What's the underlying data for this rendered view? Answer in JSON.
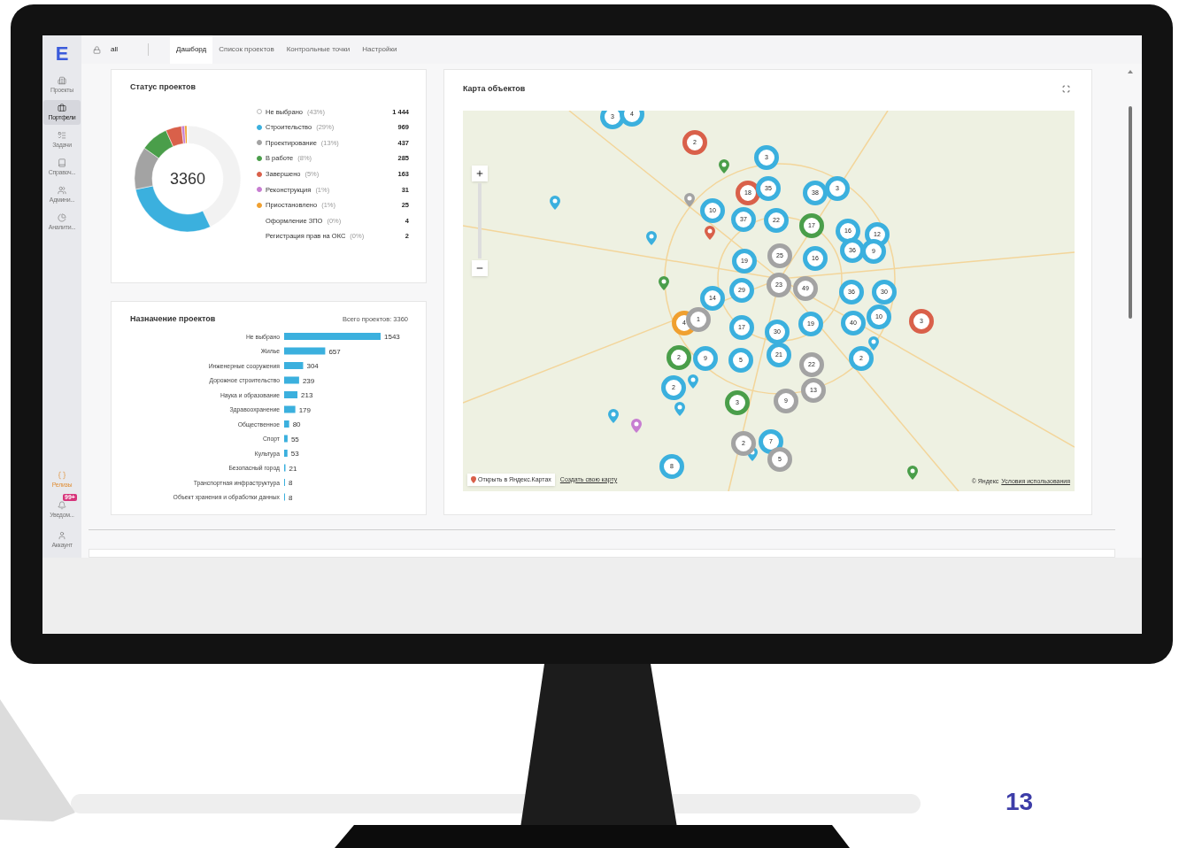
{
  "sidebar": {
    "logo": "E",
    "items": [
      {
        "label": "Проекты",
        "selected": false
      },
      {
        "label": "Портфели",
        "selected": true
      },
      {
        "label": "Задачи",
        "selected": false
      },
      {
        "label": "Справоч...",
        "selected": false
      },
      {
        "label": "Админи...",
        "selected": false
      },
      {
        "label": "Аналити...",
        "selected": false
      }
    ],
    "bottom_items": [
      {
        "label": "Релизы",
        "accent": true
      },
      {
        "label": "Уведом...",
        "accent": false,
        "badge": "99+"
      },
      {
        "label": "Аккаунт",
        "accent": false
      }
    ]
  },
  "topbar": {
    "scope": "all",
    "tabs": [
      {
        "label": "Дашборд",
        "selected": true
      },
      {
        "label": "Список проектов",
        "selected": false
      },
      {
        "label": "Контрольные точки",
        "selected": false
      },
      {
        "label": "Настройки",
        "selected": false
      }
    ]
  },
  "status_card": {
    "title": "Статус проектов",
    "total": "3360",
    "legend": [
      {
        "label": "Не выбрано",
        "share": "(43%)",
        "count": "1 444",
        "color": "#ffffff"
      },
      {
        "label": "Строительство",
        "share": "(29%)",
        "count": "969",
        "color": "#3bb0de"
      },
      {
        "label": "Проектирование",
        "share": "(13%)",
        "count": "437",
        "color": "#a3a3a3"
      },
      {
        "label": "В работе",
        "share": "(8%)",
        "count": "285",
        "color": "#4a9e4a"
      },
      {
        "label": "Завершено",
        "share": "(5%)",
        "count": "163",
        "color": "#d9604a"
      },
      {
        "label": "Реконструкция",
        "share": "(1%)",
        "count": "31",
        "color": "#c77dd1"
      },
      {
        "label": "Приостановлено",
        "share": "(1%)",
        "count": "25",
        "color": "#f0a030"
      },
      {
        "label": "Оформление ЗПО",
        "share": "(0%)",
        "count": "4"
      },
      {
        "label": "Регистрация прав на ОКС",
        "share": "(0%)",
        "count": "2"
      }
    ]
  },
  "purpose_card": {
    "title": "Назначение проектов",
    "total": "Всего проектов: 3360",
    "chart_data": {
      "type": "bar",
      "orientation": "horizontal",
      "data_labels": true,
      "categories": [
        "Не выбрано",
        "Жилье",
        "Инженерные сооружения",
        "Дорожное строительство",
        "Наука и образование",
        "Здравоохранение",
        "Общественное",
        "Спорт",
        "Культура",
        "Безопасный город",
        "Транспортная инфраструктура",
        "Объект хранения и обработки данных"
      ],
      "series": [
        {
          "color": "#3bb0de",
          "values": [
            1543,
            657,
            304,
            239,
            213,
            179,
            80,
            55,
            53,
            21,
            8,
            8
          ]
        }
      ]
    }
  },
  "map_card": {
    "title": "Карта объектов",
    "clusters": [
      {
        "count": "3",
        "color": "#3bb0de"
      },
      {
        "count": "4",
        "color": "#3bb0de"
      },
      {
        "count": "2",
        "color": "#d9604a"
      },
      {
        "count": "3",
        "color": "#3bb0de"
      },
      {
        "count": "18",
        "color": "#d9604a"
      },
      {
        "count": "35",
        "color": "#3bb0de"
      },
      {
        "count": "38",
        "color": "#3bb0de"
      },
      {
        "count": "3",
        "color": "#3bb0de"
      },
      {
        "count": "10",
        "color": "#3bb0de"
      },
      {
        "count": "37",
        "color": "#3bb0de"
      },
      {
        "count": "22",
        "color": "#3bb0de"
      },
      {
        "count": "17",
        "color": "#4a9e4a"
      },
      {
        "count": "16",
        "color": "#3bb0de"
      },
      {
        "count": "12",
        "color": "#3bb0de"
      },
      {
        "count": "36",
        "color": "#3bb0de"
      },
      {
        "count": "9",
        "color": "#3bb0de"
      },
      {
        "count": "19",
        "color": "#3bb0de"
      },
      {
        "count": "25",
        "color": "#a3a3a3"
      },
      {
        "count": "16",
        "color": "#3bb0de"
      },
      {
        "count": "29",
        "color": "#3bb0de"
      },
      {
        "count": "23",
        "color": "#a3a3a3"
      },
      {
        "count": "49",
        "color": "#a3a3a3"
      },
      {
        "count": "36",
        "color": "#3bb0de"
      },
      {
        "count": "30",
        "color": "#3bb0de"
      },
      {
        "count": "14",
        "color": "#3bb0de"
      },
      {
        "count": "4",
        "color": "#f0a030"
      },
      {
        "count": "1",
        "color": "#a3a3a3"
      },
      {
        "count": "17",
        "color": "#3bb0de"
      },
      {
        "count": "30",
        "color": "#3bb0de"
      },
      {
        "count": "19",
        "color": "#3bb0de"
      },
      {
        "count": "40",
        "color": "#3bb0de"
      },
      {
        "count": "10",
        "color": "#3bb0de"
      },
      {
        "count": "3",
        "color": "#d9604a"
      },
      {
        "count": "2",
        "color": "#4a9e4a"
      },
      {
        "count": "9",
        "color": "#3bb0de"
      },
      {
        "count": "5",
        "color": "#3bb0de"
      },
      {
        "count": "21",
        "color": "#3bb0de"
      },
      {
        "count": "22",
        "color": "#a3a3a3"
      },
      {
        "count": "2",
        "color": "#3bb0de"
      },
      {
        "count": "2",
        "color": "#3bb0de"
      },
      {
        "count": "13",
        "color": "#a3a3a3"
      },
      {
        "count": "3",
        "color": "#4a9e4a"
      },
      {
        "count": "9",
        "color": "#a3a3a3"
      },
      {
        "count": "2",
        "color": "#a3a3a3"
      },
      {
        "count": "7",
        "color": "#3bb0de"
      },
      {
        "count": "5",
        "color": "#a3a3a3"
      },
      {
        "count": "8",
        "color": "#3bb0de"
      }
    ],
    "pins": [
      {
        "color": "#4a9e4a"
      },
      {
        "color": "#a3a3a3"
      },
      {
        "color": "#3bb0de"
      },
      {
        "color": "#d9604a"
      },
      {
        "color": "#3bb0de"
      },
      {
        "color": "#4a9e4a"
      },
      {
        "color": "#3bb0de"
      },
      {
        "color": "#3bb0de"
      },
      {
        "color": "#3bb0de"
      },
      {
        "color": "#3bb0de"
      },
      {
        "color": "#c77dd1"
      },
      {
        "color": "#4a9e4a"
      },
      {
        "color": "#3bb0de"
      }
    ],
    "open_button": "Открыть в Яндекс.Картах",
    "create_link": "Создать свою карту",
    "copyright": "© Яндекс",
    "terms_link": "Условия использования"
  },
  "page_number": "13"
}
